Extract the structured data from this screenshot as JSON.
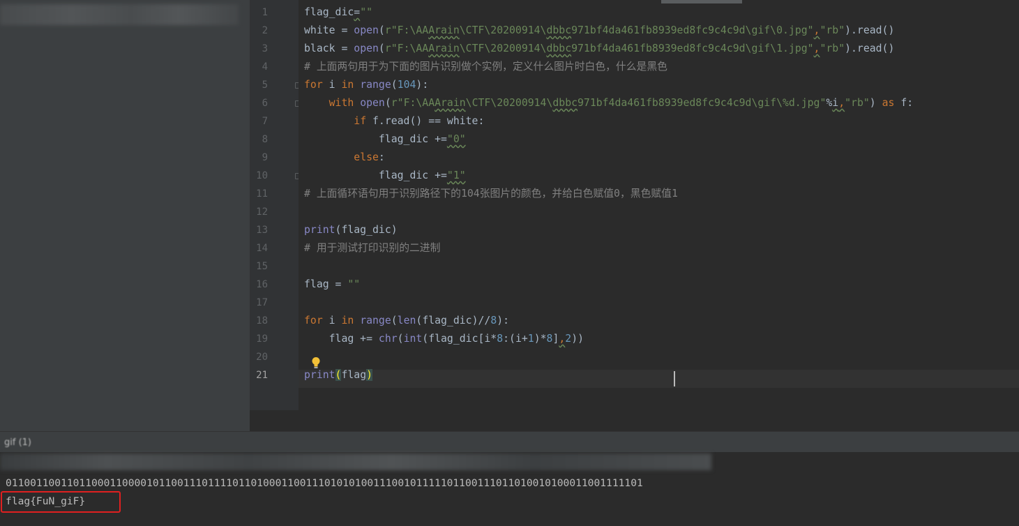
{
  "run_tab_label": "gif (1)",
  "console": {
    "blurred_line": "...(F) thons ...",
    "binary_output": "01100110011011000110000101100111011110110100011001110101010011100101111101100111011010010100011001111101",
    "flag_output": "flag{FuN_giF}"
  },
  "editor": {
    "current_line": 21,
    "line_numbers": [
      "1",
      "2",
      "3",
      "4",
      "5",
      "6",
      "7",
      "8",
      "9",
      "10",
      "11",
      "12",
      "13",
      "14",
      "15",
      "16",
      "17",
      "18",
      "19",
      "20",
      "21"
    ],
    "lines": [
      [
        {
          "t": "flag_dic",
          "c": ""
        },
        {
          "t": "=",
          "c": "sq"
        },
        {
          "t": "\"\"",
          "c": "str"
        }
      ],
      [
        {
          "t": "white = ",
          "c": ""
        },
        {
          "t": "open",
          "c": "bi"
        },
        {
          "t": "(",
          "c": ""
        },
        {
          "t": "r\"F:\\AA",
          "c": "str"
        },
        {
          "t": "Arain",
          "c": "str sq"
        },
        {
          "t": "\\CTF\\20200914\\",
          "c": "str"
        },
        {
          "t": "dbbc",
          "c": "str sq"
        },
        {
          "t": "971bf4da461fb8939ed8fc9c4c9d\\gif\\0.jpg\"",
          "c": "str"
        },
        {
          "t": ",",
          "c": "kw sq"
        },
        {
          "t": "\"rb\"",
          "c": "str"
        },
        {
          "t": ").read()",
          "c": ""
        }
      ],
      [
        {
          "t": "black = ",
          "c": ""
        },
        {
          "t": "open",
          "c": "bi"
        },
        {
          "t": "(",
          "c": ""
        },
        {
          "t": "r\"F:\\AA",
          "c": "str"
        },
        {
          "t": "Arain",
          "c": "str sq"
        },
        {
          "t": "\\CTF\\20200914\\",
          "c": "str"
        },
        {
          "t": "dbbc",
          "c": "str sq"
        },
        {
          "t": "971bf4da461fb8939ed8fc9c4c9d\\gif\\1.jpg\"",
          "c": "str"
        },
        {
          "t": ",",
          "c": "kw sq"
        },
        {
          "t": "\"rb\"",
          "c": "str"
        },
        {
          "t": ").read()",
          "c": ""
        }
      ],
      [
        {
          "t": "# 上面两句用于为下面的图片识别做个实例，定义什么图片时白色，什么是黑色",
          "c": "cm"
        }
      ],
      [
        {
          "t": "for ",
          "c": "kw"
        },
        {
          "t": "i ",
          "c": ""
        },
        {
          "t": "in ",
          "c": "kw"
        },
        {
          "t": "range",
          "c": "bi"
        },
        {
          "t": "(",
          "c": ""
        },
        {
          "t": "104",
          "c": "num"
        },
        {
          "t": "):",
          "c": ""
        }
      ],
      [
        {
          "t": "    ",
          "c": ""
        },
        {
          "t": "with ",
          "c": "kw"
        },
        {
          "t": "open",
          "c": "bi"
        },
        {
          "t": "(",
          "c": ""
        },
        {
          "t": "r\"F:\\AA",
          "c": "str"
        },
        {
          "t": "Arain",
          "c": "str sq"
        },
        {
          "t": "\\CTF\\20200914\\",
          "c": "str"
        },
        {
          "t": "dbbc",
          "c": "str sq"
        },
        {
          "t": "971bf4da461fb8939ed8fc9c4c9d\\gif\\%d.jpg\"",
          "c": "str"
        },
        {
          "t": "%",
          "c": ""
        },
        {
          "t": "i",
          "c": "sq"
        },
        {
          "t": ",",
          "c": "kw sq"
        },
        {
          "t": "\"rb\"",
          "c": "str"
        },
        {
          "t": ") ",
          "c": ""
        },
        {
          "t": "as ",
          "c": "kw"
        },
        {
          "t": "f:",
          "c": ""
        }
      ],
      [
        {
          "t": "        ",
          "c": ""
        },
        {
          "t": "if ",
          "c": "kw"
        },
        {
          "t": "f.read() == white:",
          "c": ""
        }
      ],
      [
        {
          "t": "            flag_dic +=",
          "c": ""
        },
        {
          "t": "\"0\"",
          "c": "str sq"
        }
      ],
      [
        {
          "t": "        ",
          "c": ""
        },
        {
          "t": "else",
          "c": "kw"
        },
        {
          "t": ":",
          "c": ""
        }
      ],
      [
        {
          "t": "            flag_dic +=",
          "c": ""
        },
        {
          "t": "\"1\"",
          "c": "str sq"
        }
      ],
      [
        {
          "t": "# 上面循环语句用于识别路径下的104张图片的颜色，并给白色赋值0，黑色赋值1",
          "c": "cm"
        }
      ],
      [],
      [
        {
          "t": "print",
          "c": "bi"
        },
        {
          "t": "(flag_dic)",
          "c": ""
        }
      ],
      [
        {
          "t": "# 用于测试打印识别的二进制",
          "c": "cm"
        }
      ],
      [],
      [
        {
          "t": "flag = ",
          "c": ""
        },
        {
          "t": "\"\"",
          "c": "str"
        }
      ],
      [],
      [
        {
          "t": "for ",
          "c": "kw"
        },
        {
          "t": "i ",
          "c": ""
        },
        {
          "t": "in ",
          "c": "kw"
        },
        {
          "t": "range",
          "c": "bi"
        },
        {
          "t": "(",
          "c": ""
        },
        {
          "t": "len",
          "c": "bi"
        },
        {
          "t": "(flag_dic)//",
          "c": ""
        },
        {
          "t": "8",
          "c": "num"
        },
        {
          "t": "):",
          "c": ""
        }
      ],
      [
        {
          "t": "    flag += ",
          "c": ""
        },
        {
          "t": "chr",
          "c": "bi"
        },
        {
          "t": "(",
          "c": ""
        },
        {
          "t": "int",
          "c": "bi"
        },
        {
          "t": "(flag_dic[i*",
          "c": ""
        },
        {
          "t": "8",
          "c": "num"
        },
        {
          "t": ":(i+",
          "c": ""
        },
        {
          "t": "1",
          "c": "num"
        },
        {
          "t": ")*",
          "c": ""
        },
        {
          "t": "8",
          "c": "num"
        },
        {
          "t": "]",
          "c": ""
        },
        {
          "t": ",",
          "c": "kw sq"
        },
        {
          "t": "2",
          "c": "num"
        },
        {
          "t": "))",
          "c": ""
        }
      ],
      [],
      [
        {
          "t": "print",
          "c": "bi"
        },
        {
          "t": "(",
          "c": "bracket"
        },
        {
          "t": "flag",
          "c": ""
        },
        {
          "t": ")",
          "c": "bracket"
        }
      ]
    ]
  },
  "icons": {
    "intention": "lightbulb-icon",
    "fold": "fold-marker-icon"
  },
  "colors": {
    "editor_bg": "#2b2b2b",
    "keyword": "#cc7832",
    "string": "#6a8759",
    "number": "#6897bb",
    "builtin": "#8888c6",
    "comment": "#808080",
    "highlight_box": "#e02020"
  }
}
